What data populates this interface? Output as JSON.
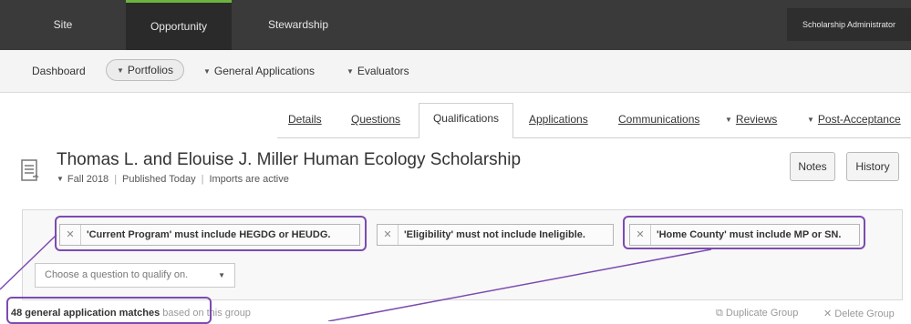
{
  "top_nav": {
    "tabs": [
      {
        "label": "Site"
      },
      {
        "label": "Opportunity"
      },
      {
        "label": "Stewardship"
      }
    ],
    "active_tab": "Opportunity",
    "user_role": "Scholarship Administrator"
  },
  "sub_nav": {
    "items": [
      {
        "label": "Dashboard"
      },
      {
        "label": "Portfolios"
      },
      {
        "label": "General Applications"
      },
      {
        "label": "Evaluators"
      }
    ]
  },
  "content_tabs": {
    "items": [
      {
        "label": "Details"
      },
      {
        "label": "Questions"
      },
      {
        "label": "Qualifications"
      },
      {
        "label": "Applications"
      },
      {
        "label": "Communications"
      },
      {
        "label": "Reviews"
      },
      {
        "label": "Post-Acceptance"
      }
    ],
    "active": "Qualifications"
  },
  "page": {
    "title": "Thomas L. and Elouise J. Miller Human Ecology Scholarship",
    "term": "Fall 2018",
    "published": "Published Today",
    "imports": "Imports are active",
    "notes_label": "Notes",
    "history_label": "History"
  },
  "qualification_group": {
    "conditions": [
      {
        "text": "'Current Program' must include HEGDG or HEUDG."
      },
      {
        "text": "'Eligibility' must not include Ineligible."
      },
      {
        "text": "'Home County' must include MP or SN."
      }
    ],
    "select_placeholder": "Choose a question to qualify on.",
    "matches_count_text": "48 general application matches",
    "matches_rest_text": "based on this group",
    "duplicate_label": "Duplicate Group",
    "delete_label": "Delete Group"
  },
  "colors": {
    "top_nav_bg": "#3a3a3a",
    "active_accent": "#6db33f",
    "annotation_highlight": "#7b4bb0"
  }
}
